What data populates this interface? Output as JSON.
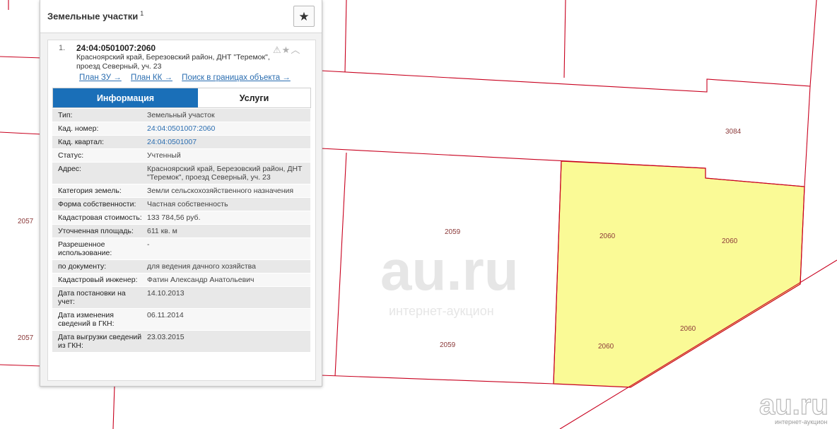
{
  "panel": {
    "title": "Земельные участки",
    "title_count": "1",
    "star_icon": "★"
  },
  "card": {
    "number": "1.",
    "cadastral_number": "24:04:0501007:2060",
    "address": "Красноярский край, Березовский район, ДНТ \"Теремок\", проезд Северный, уч. 23",
    "action_icons": {
      "warning": "⚠",
      "star": "★",
      "collapse": "︿"
    },
    "links": [
      {
        "label": "План ЗУ →"
      },
      {
        "label": "План КК →"
      },
      {
        "label": "Поиск в границах объекта →"
      }
    ],
    "tabs": {
      "info": "Информация",
      "services": "Услуги"
    },
    "rows": [
      {
        "label": "Тип:",
        "value": "Земельный участок"
      },
      {
        "label": "Кад. номер:",
        "value": "24:04:0501007:2060",
        "link": true
      },
      {
        "label": "Кад. квартал:",
        "value": "24:04:0501007",
        "link": true
      },
      {
        "label": "Статус:",
        "value": "Учтенный"
      },
      {
        "label": "Адрес:",
        "value": "Красноярский край, Березовский район, ДНТ \"Теремок\", проезд Северный, уч. 23"
      },
      {
        "label": "Категория земель:",
        "value": "Земли сельскохозяйственного назначения"
      },
      {
        "label": "Форма собственности:",
        "value": "Частная собственность"
      },
      {
        "label": "Кадастровая стоимость:",
        "value": "133 784,56 руб."
      },
      {
        "label": "Уточненная площадь:",
        "value": "611 кв. м"
      },
      {
        "label": "Разрешенное использование:",
        "value": "-"
      },
      {
        "label": "по документу:",
        "value": "для ведения дачного хозяйства"
      },
      {
        "label": "Кадастровый инженер:",
        "value": "Фатин Александр Анатольевич"
      },
      {
        "label": "Дата постановки на учет:",
        "value": "14.10.2013"
      },
      {
        "label": "Дата изменения сведений в ГКН:",
        "value": "06.11.2014"
      },
      {
        "label": "Дата выгрузки сведений из ГКН:",
        "value": "23.03.2015"
      }
    ]
  },
  "map": {
    "labels": {
      "p3084": "3084",
      "p2059_top": "2059",
      "p2059_bottom": "2059",
      "p2060_a": "2060",
      "p2060_b": "2060",
      "p2060_c": "2060",
      "p2060_d": "2060",
      "p2057_top": "2057",
      "p2057_bottom": "2057"
    },
    "colors": {
      "boundary": "#c8001e",
      "selected_fill": "#fafa96"
    },
    "watermark": {
      "main": "au.ru",
      "sub": "интернет-аукцион",
      "corner": "au.ru",
      "corner_sub": "интернет-аукцион"
    }
  }
}
